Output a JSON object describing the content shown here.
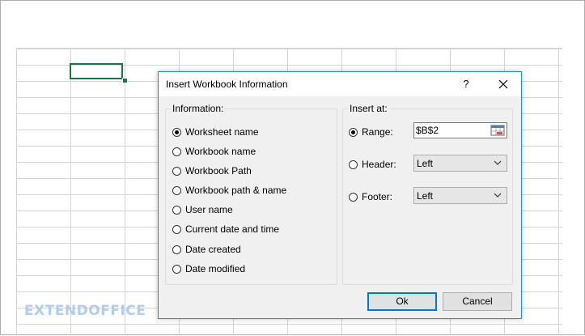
{
  "dialog": {
    "title": "Insert Workbook Information",
    "help_label": "?",
    "close_label": "Close"
  },
  "information": {
    "label": "Information:",
    "options": [
      {
        "label": "Worksheet name",
        "checked": true
      },
      {
        "label": "Workbook name",
        "checked": false
      },
      {
        "label": "Workbook Path",
        "checked": false
      },
      {
        "label": "Workbook path & name",
        "checked": false
      },
      {
        "label": "User name",
        "checked": false
      },
      {
        "label": "Current date and time",
        "checked": false
      },
      {
        "label": "Date created",
        "checked": false
      },
      {
        "label": "Date modified",
        "checked": false
      }
    ]
  },
  "insert_at": {
    "label": "Insert at:",
    "range": {
      "label": "Range:",
      "value": "$B$2",
      "checked": true
    },
    "header": {
      "label": "Header:",
      "value": "Left",
      "checked": false
    },
    "footer": {
      "label": "Footer:",
      "value": "Left",
      "checked": false
    }
  },
  "buttons": {
    "ok": "Ok",
    "cancel": "Cancel"
  },
  "watermark": "EXTENDOFFICE",
  "colors": {
    "accent": "#1d8be0",
    "selection": "#217346"
  }
}
